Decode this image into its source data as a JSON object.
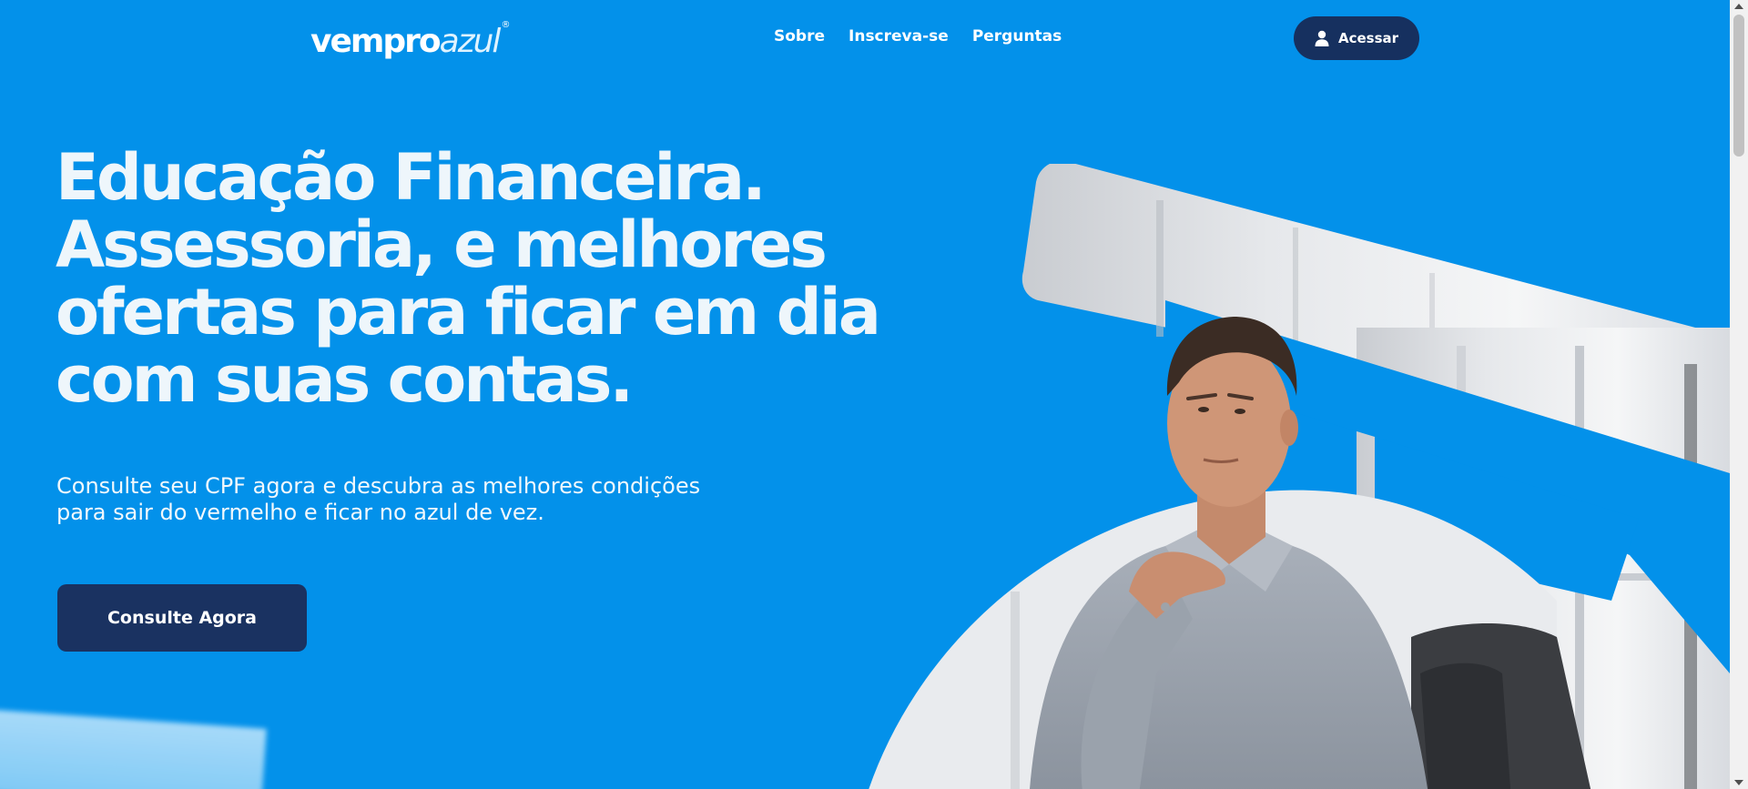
{
  "header": {
    "logo": {
      "part_a": "vempro",
      "part_b": "azul",
      "mark": "®"
    },
    "nav": [
      {
        "label": "Sobre"
      },
      {
        "label": "Inscreva-se"
      },
      {
        "label": "Perguntas"
      }
    ],
    "login": {
      "label": "Acessar",
      "icon": "user-icon"
    }
  },
  "hero": {
    "title_lines": [
      "Educação Financeira.",
      "Assessoria, e melhores",
      "ofertas para ficar em dia",
      "com suas contas."
    ],
    "subtitle_lines": [
      "Consulte seu CPF agora e descubra as melhores condições",
      "para sair do vermelho e ficar no azul de vez."
    ],
    "cta_label": "Consulte Agora"
  },
  "colors": {
    "background": "#0391ea",
    "dark_navy": "#16305f",
    "text_light": "#eef6fb"
  }
}
